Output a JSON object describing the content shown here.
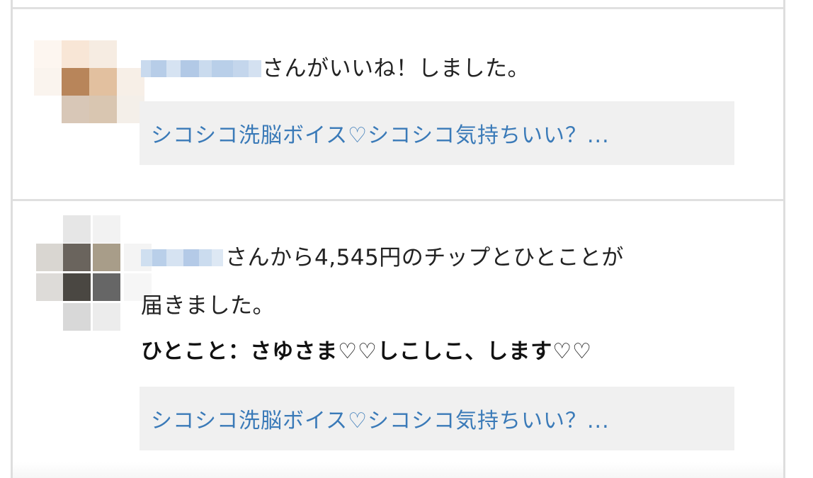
{
  "notifications": [
    {
      "type": "like",
      "message": "さんがいいね！しました。",
      "link_title": "シコシコ洗脳ボイス♡シコシコ気持ちいい？..."
    },
    {
      "type": "tip",
      "message_line1": "さんから4,545円のチップとひとことが",
      "message_line2": "届きました。",
      "comment": "ひとこと：さゆさま♡♡しこしこ、します♡♡",
      "link_title": "シコシコ洗脳ボイス♡シコシコ気持ちいい？..."
    }
  ],
  "colors": {
    "link": "#3a7ab8",
    "link_box_bg": "#f0f0f0",
    "divider": "#e0e0e0",
    "text": "#222222",
    "username_mosaic": "#b9cfe9"
  },
  "icons": {
    "avatar": "pixelated-avatar",
    "username": "pixelated-username"
  }
}
